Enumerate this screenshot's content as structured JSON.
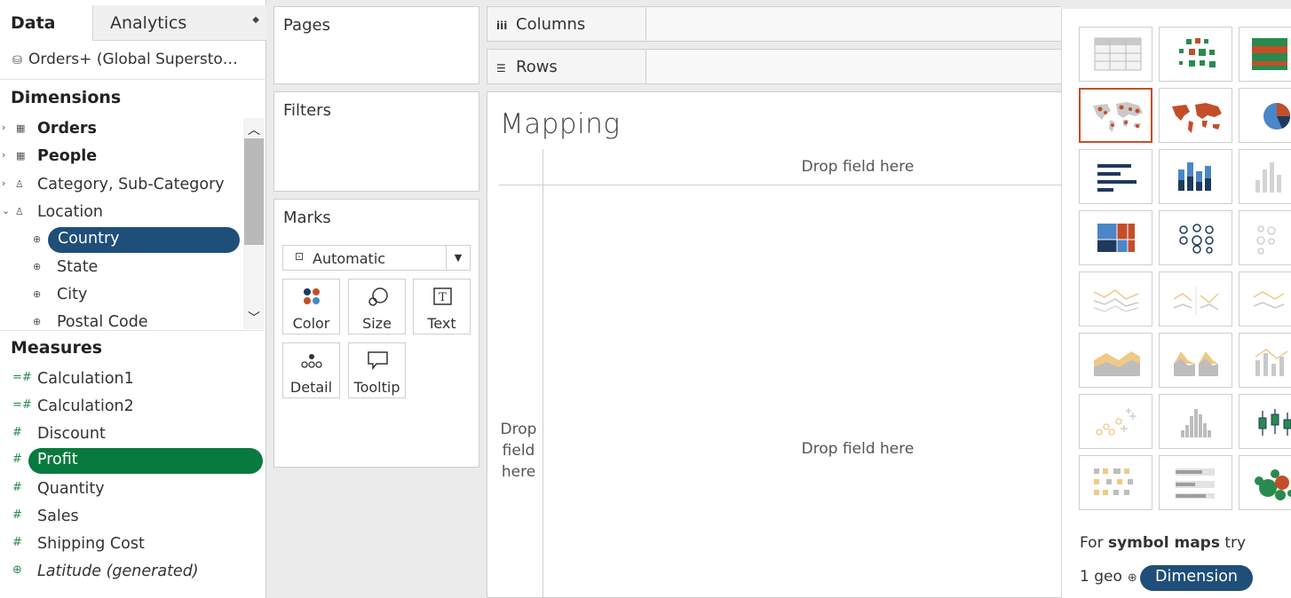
{
  "data_pane": {
    "tabs": {
      "data": "Data",
      "analytics": "Analytics"
    },
    "datasource": "Orders+ (Global Supersto…",
    "dimensions_header": "Dimensions",
    "dimension_items": [
      {
        "label": "Orders",
        "icon": "table-icon",
        "expanded": false
      },
      {
        "label": "People",
        "icon": "table-icon",
        "expanded": false
      },
      {
        "label": "Category, Sub-Category",
        "icon": "hierarchy-icon",
        "expanded": false
      },
      {
        "label": "Location",
        "icon": "hierarchy-icon",
        "expanded": true
      },
      {
        "label": "Country",
        "icon": "globe-icon",
        "selected": true
      },
      {
        "label": "State",
        "icon": "globe-icon"
      },
      {
        "label": "City",
        "icon": "globe-icon"
      },
      {
        "label": "Postal Code",
        "icon": "globe-icon"
      }
    ],
    "measures_header": "Measures",
    "measure_items": [
      {
        "label": "Calculation1",
        "icon": "calc-measure-icon"
      },
      {
        "label": "Calculation2",
        "icon": "calc-measure-icon"
      },
      {
        "label": "Discount",
        "icon": "measure-icon"
      },
      {
        "label": "Profit",
        "icon": "measure-icon",
        "selected": true
      },
      {
        "label": "Quantity",
        "icon": "measure-icon"
      },
      {
        "label": "Sales",
        "icon": "measure-icon"
      },
      {
        "label": "Shipping Cost",
        "icon": "measure-icon"
      },
      {
        "label": "Latitude (generated)",
        "icon": "globe-icon",
        "italic": true
      }
    ]
  },
  "cards": {
    "pages": "Pages",
    "filters": "Filters",
    "marks": {
      "title": "Marks",
      "mark_type": "Automatic",
      "buttons": {
        "color": "Color",
        "size": "Size",
        "text": "Text",
        "detail": "Detail",
        "tooltip": "Tooltip"
      }
    }
  },
  "shelves": {
    "columns": "Columns",
    "rows": "Rows"
  },
  "sheet": {
    "title": "Mapping",
    "drop_top": "Drop field here",
    "drop_left": [
      "Drop",
      "field",
      "here"
    ],
    "drop_center": "Drop field here"
  },
  "show_me": {
    "selected_tile": "symbol-map",
    "hint_prefix": "For ",
    "hint_bold": "symbol maps",
    "hint_suffix": " try",
    "hint2_prefix": "1 geo",
    "pill": "Dimension"
  },
  "colors": {
    "dimension_blue": "#1f4e79",
    "measure_green": "#087a3e",
    "selected_tile_border": "#c44e28",
    "map_orange": "#c44e28",
    "chart_blue": "#4a86c8",
    "chart_navy": "#1f3a5c"
  }
}
